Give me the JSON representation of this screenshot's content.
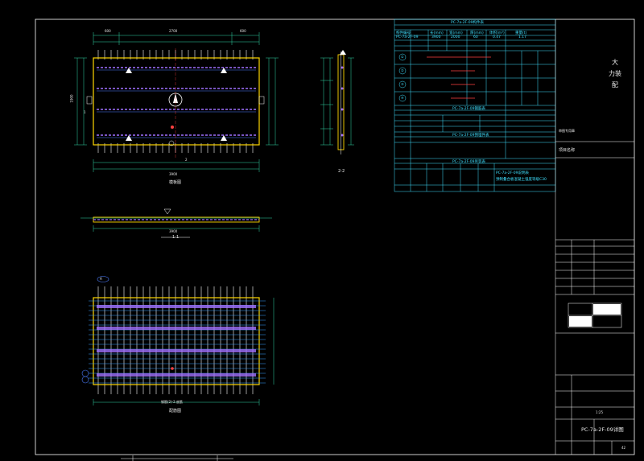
{
  "drawing": {
    "sheet_label": "PC-7a-2F-09详图",
    "page_number": "42",
    "views": {
      "plan_caption": "模板图",
      "side_section": "2-2",
      "long_section": "1-1",
      "rebar_caption": "配筋图",
      "rebar_note": "钢筋(2)-2.底筋",
      "axis_1": "1",
      "axis_2": "2",
      "axis_A": "A"
    },
    "dims": {
      "plan_total": "3900",
      "plan_seg_left": "600",
      "plan_seg_mid": "2700",
      "plan_seg_right": "600",
      "plan_height": "1900",
      "section_length": "3900"
    },
    "tables": {
      "panel_title": "PC-7a-2F-09构件表",
      "panel_headers": [
        "构件编号",
        "长(mm)",
        "宽(mm)",
        "厚(mm)",
        "体积(m³)",
        "重量(t)"
      ],
      "panel_row": [
        "PC-7a-2F-09",
        "3900",
        "2000",
        "60",
        "0.47",
        "1.17"
      ],
      "rebar_title": "PC-7a-2F-09钢筋表",
      "rebar_rows": [
        "①",
        "②",
        "③",
        "④"
      ],
      "embed_title": "PC-7a-2F-09预埋件表",
      "lift_title": "PC-7a-2F-09吊装表",
      "note_title": "PC-7a-2F-09说明表",
      "note_text": "预制叠合板混凝土强度等级C30"
    },
    "title_block": {
      "heading_1": "大",
      "heading_2": "力装",
      "heading_3": "配",
      "stamp_note": "审图专用章",
      "project_label": "项目名称",
      "scale": "1:25"
    }
  }
}
